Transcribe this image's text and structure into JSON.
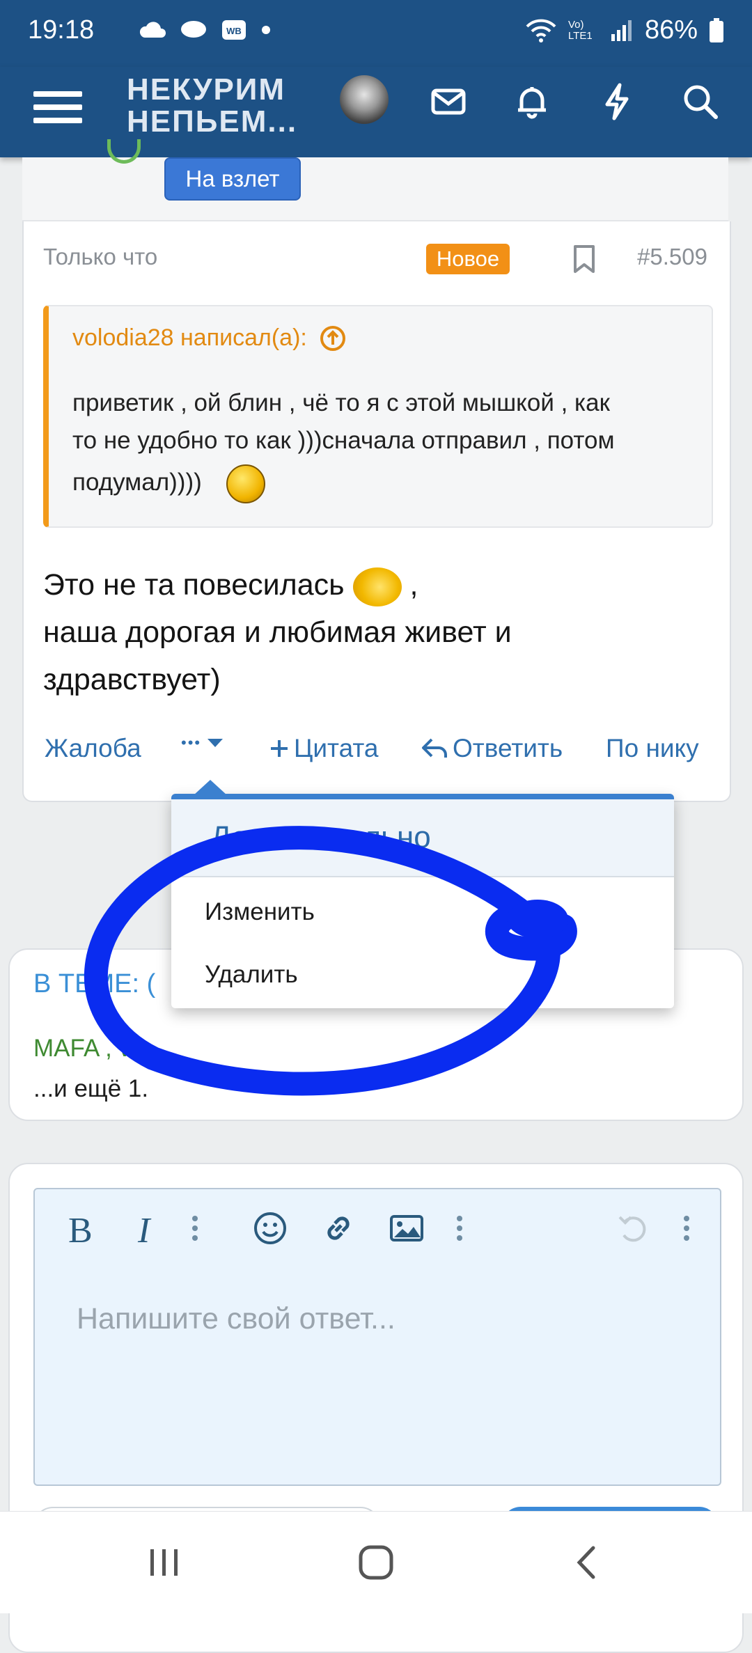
{
  "status_bar": {
    "time": "19:18",
    "network_label": "Vo) LTE1",
    "battery": "86%"
  },
  "app_bar": {
    "title_line1": "НЕКУРИМ",
    "title_line2": "НЕПЬЕМ..."
  },
  "prev_post": {
    "badge": "На взлет"
  },
  "post": {
    "time": "Только что",
    "new_badge": "Новое",
    "number": "#5.509",
    "quote": {
      "author": "volodia28 написал(а):",
      "line1": "приветик , ой блин , чё то я с этой мышкой , как",
      "line2": "то не удобно то как )))сначала отправил , потом",
      "line3": "подумал))))"
    },
    "text": {
      "line1": "Это не та повесилась",
      "line1_tail": ",",
      "line2": "наша дорогая и любимая живет и",
      "line3": "здравствует)"
    },
    "actions": {
      "report": "Жалоба",
      "more": "•••",
      "quote": "Цитата",
      "reply": "Ответить",
      "by_nick": "По нику"
    }
  },
  "dropdown": {
    "header": "Дополнительно",
    "items": [
      "Изменить",
      "Удалить"
    ]
  },
  "theme": {
    "title": "В ТЕМЕ: (",
    "users": "MAFA , vo",
    "more": "...и ещё 1."
  },
  "editor": {
    "bold": "B",
    "italic": "I",
    "placeholder": "Напишите свой ответ..."
  },
  "colors": {
    "brand": "#1d5185",
    "accent_orange": "#f29016",
    "link_blue": "#2f6fae",
    "scribble": "#0a2cf0"
  }
}
